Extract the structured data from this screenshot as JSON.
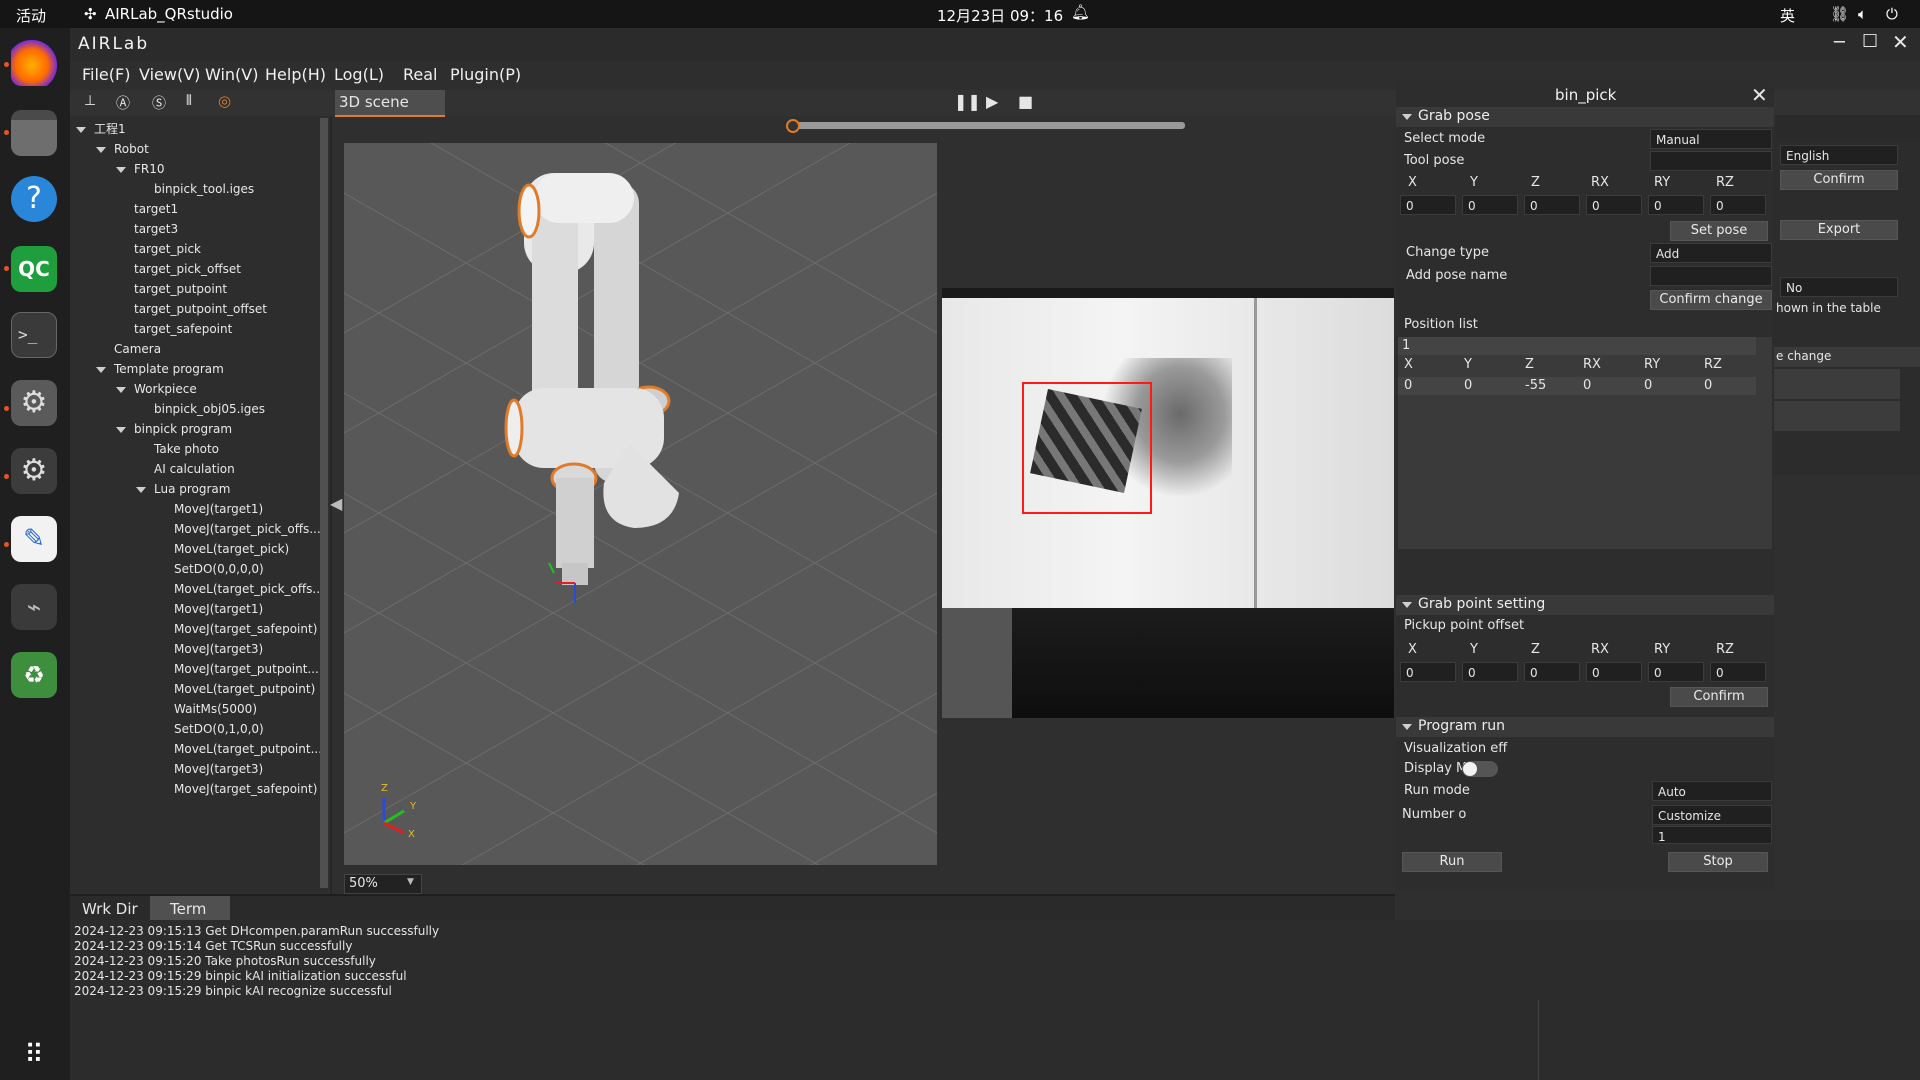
{
  "system_bar": {
    "activities": "活动",
    "app_name": "AIRLab_QRstudio",
    "clock": "12月23日  09：16",
    "input_method": "英"
  },
  "app": {
    "logo": "AIRLab",
    "menu": [
      "File(F)",
      "View(V)",
      "Win(V)",
      "Help(H)",
      "Log(L)",
      "Real",
      "Plugin(P)"
    ],
    "toolbar_icons": [
      "axis-icon",
      "auto-icon",
      "s-icon",
      "gripper-icon",
      "target-icon"
    ]
  },
  "tree": {
    "items": [
      {
        "label": "工程1",
        "expanded": true
      },
      {
        "label": "Robot",
        "expanded": true
      },
      {
        "label": "FR10",
        "expanded": true
      },
      {
        "label": "binpick_tool.iges"
      },
      {
        "label": "target1"
      },
      {
        "label": "target3"
      },
      {
        "label": "target_pick"
      },
      {
        "label": "target_pick_offset"
      },
      {
        "label": "target_putpoint"
      },
      {
        "label": "target_putpoint_offset"
      },
      {
        "label": "target_safepoint"
      },
      {
        "label": "Camera"
      },
      {
        "label": "Template program",
        "expanded": true
      },
      {
        "label": "Workpiece",
        "expanded": true
      },
      {
        "label": "binpick_obj05.iges"
      },
      {
        "label": "binpick program",
        "expanded": true
      },
      {
        "label": "Take photo"
      },
      {
        "label": "AI calculation"
      },
      {
        "label": "Lua program",
        "expanded": true
      },
      {
        "label": "MoveJ(target1)"
      },
      {
        "label": "MoveJ(target_pick_offs..."
      },
      {
        "label": "MoveL(target_pick)"
      },
      {
        "label": "SetDO(0,0,0,0)"
      },
      {
        "label": "MoveL(target_pick_offs..."
      },
      {
        "label": "MoveJ(target1)"
      },
      {
        "label": "MoveJ(target_safepoint)"
      },
      {
        "label": "MoveJ(target3)"
      },
      {
        "label": "MoveJ(target_putpoint..."
      },
      {
        "label": "MoveL(target_putpoint)"
      },
      {
        "label": "WaitMs(5000)"
      },
      {
        "label": "SetDO(0,1,0,0)"
      },
      {
        "label": "MoveL(target_putpoint..."
      },
      {
        "label": "MoveJ(target3)"
      },
      {
        "label": "MoveJ(target_safepoint)"
      }
    ]
  },
  "scene": {
    "tab": "3D scene",
    "zoom": "50%",
    "progress": 0.0,
    "axis_labels": {
      "z": "Z",
      "y": "Y",
      "x": "X"
    }
  },
  "bottom": {
    "tabs": [
      "Wrk Dir",
      "Term"
    ],
    "active_tab": "Term",
    "log": [
      "2024-12-23 09:15:13 Get DHcompen.paramRun successfully",
      "2024-12-23 09:15:14 Get TCSRun successfully",
      "2024-12-23 09:15:20 Take photosRun successfully",
      "2024-12-23 09:15:29 binpic kAI initialization successful",
      "2024-12-23 09:15:29 binpic kAI recognize successful"
    ]
  },
  "bin_pick": {
    "title": "bin_pick",
    "grab_pose": {
      "header": "Grab pose",
      "select_mode_label": "Select mode",
      "select_mode_value": "Manual",
      "tool_pose_label": "Tool pose",
      "tool_pose_value": "",
      "cols": [
        "X",
        "Y",
        "Z",
        "RX",
        "RY",
        "RZ"
      ],
      "values": [
        "0",
        "0",
        "0",
        "0",
        "0",
        "0"
      ],
      "set_pose": "Set pose",
      "change_type_label": "Change type",
      "change_type_value": "Add",
      "add_pose_name_label": "Add pose name",
      "add_pose_name_value": "",
      "confirm_change": "Confirm change",
      "position_list_label": "Position list",
      "position_list_index": "1",
      "list_cols": [
        "X",
        "Y",
        "Z",
        "RX",
        "RY",
        "RZ"
      ],
      "list_values": [
        "0",
        "0",
        "-55",
        "0",
        "0",
        "0"
      ]
    },
    "grab_point": {
      "header": "Grab point setting",
      "offset_label": "Pickup point offset",
      "cols": [
        "X",
        "Y",
        "Z",
        "RX",
        "RY",
        "RZ"
      ],
      "values": [
        "0",
        "0",
        "0",
        "0",
        "0",
        "0"
      ],
      "confirm": "Confirm"
    },
    "program_run": {
      "header": "Program run",
      "visualization": "Visualization eff",
      "display": "Display M",
      "run_mode_label": "Run mode",
      "run_mode_value": "Auto",
      "number_label": "Number o",
      "number_mode": "Customize",
      "number_value": "1",
      "run": "Run",
      "stop": "Stop"
    }
  },
  "back_panel": {
    "language": "English",
    "confirm": "Confirm",
    "export": "Export",
    "no": "No",
    "hint": "hown in the table",
    "change": "e change"
  }
}
